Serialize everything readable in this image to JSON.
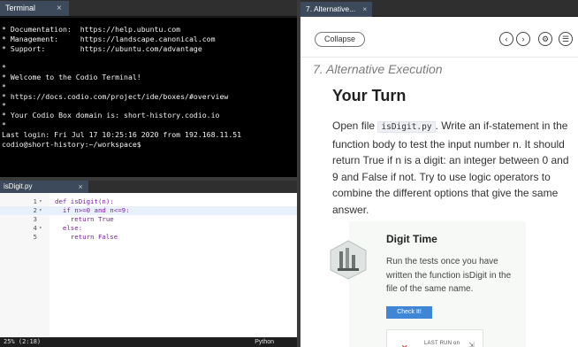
{
  "terminal_tab": {
    "label": "Terminal",
    "close": "×"
  },
  "terminal": {
    "lines": [
      "* Documentation:  https://help.ubuntu.com",
      "* Management:     https://landscape.canonical.com",
      "* Support:        https://ubuntu.com/advantage",
      "",
      "*",
      "* Welcome to the Codio Terminal!",
      "*",
      "* https://docs.codio.com/project/ide/boxes/#overview",
      "*",
      "* Your Codio Box domain is: short-history.codio.io",
      "*",
      "Last login: Fri Jul 17 10:25:16 2020 from 192.168.11.51",
      "codio@short-history:~/workspace$"
    ]
  },
  "editor_tab": {
    "label": "isDigit.py",
    "close": "×"
  },
  "editor": {
    "lines": [
      {
        "num": "1",
        "fold": "▾",
        "code": "def isDigit(n):"
      },
      {
        "num": "2",
        "fold": "▾",
        "code": "  if n>=0 and n<=9:"
      },
      {
        "num": "3",
        "fold": "",
        "code": "    return True"
      },
      {
        "num": "4",
        "fold": "▾",
        "code": "  else:"
      },
      {
        "num": "5",
        "fold": "",
        "code": "    return False"
      }
    ]
  },
  "statusbar": {
    "position": "25% (2:18)",
    "language": "Python"
  },
  "guide_tab": {
    "label": "7. Alternative...",
    "close": "×"
  },
  "guide": {
    "collapse_label": "Collapse",
    "icons": {
      "prev": "chevron-left-icon",
      "next": "chevron-right-icon",
      "settings": "gear-icon",
      "menu": "list-icon"
    },
    "section_title": "7. Alternative Execution",
    "heading": "Your Turn",
    "body_before": "Open file ",
    "inline_code": "isDigit.py",
    "body_after": ". Write an if-statement in the function body to test the input number n. It should return True if n is a digit: an integer between 0 and 9 and False if not. Try to use logic operators to combine the different options that give the same answer.",
    "card": {
      "title": "Digit Time",
      "description": "Run the tests once you have written the function isDigit in the file of the same name.",
      "button_label": "Check It!",
      "last_run_label": "LAST RUN on"
    }
  },
  "colors": {
    "accent": "#3f86d6",
    "tab_active": "#3d4a5c",
    "keyword": "#7a1fa2"
  }
}
